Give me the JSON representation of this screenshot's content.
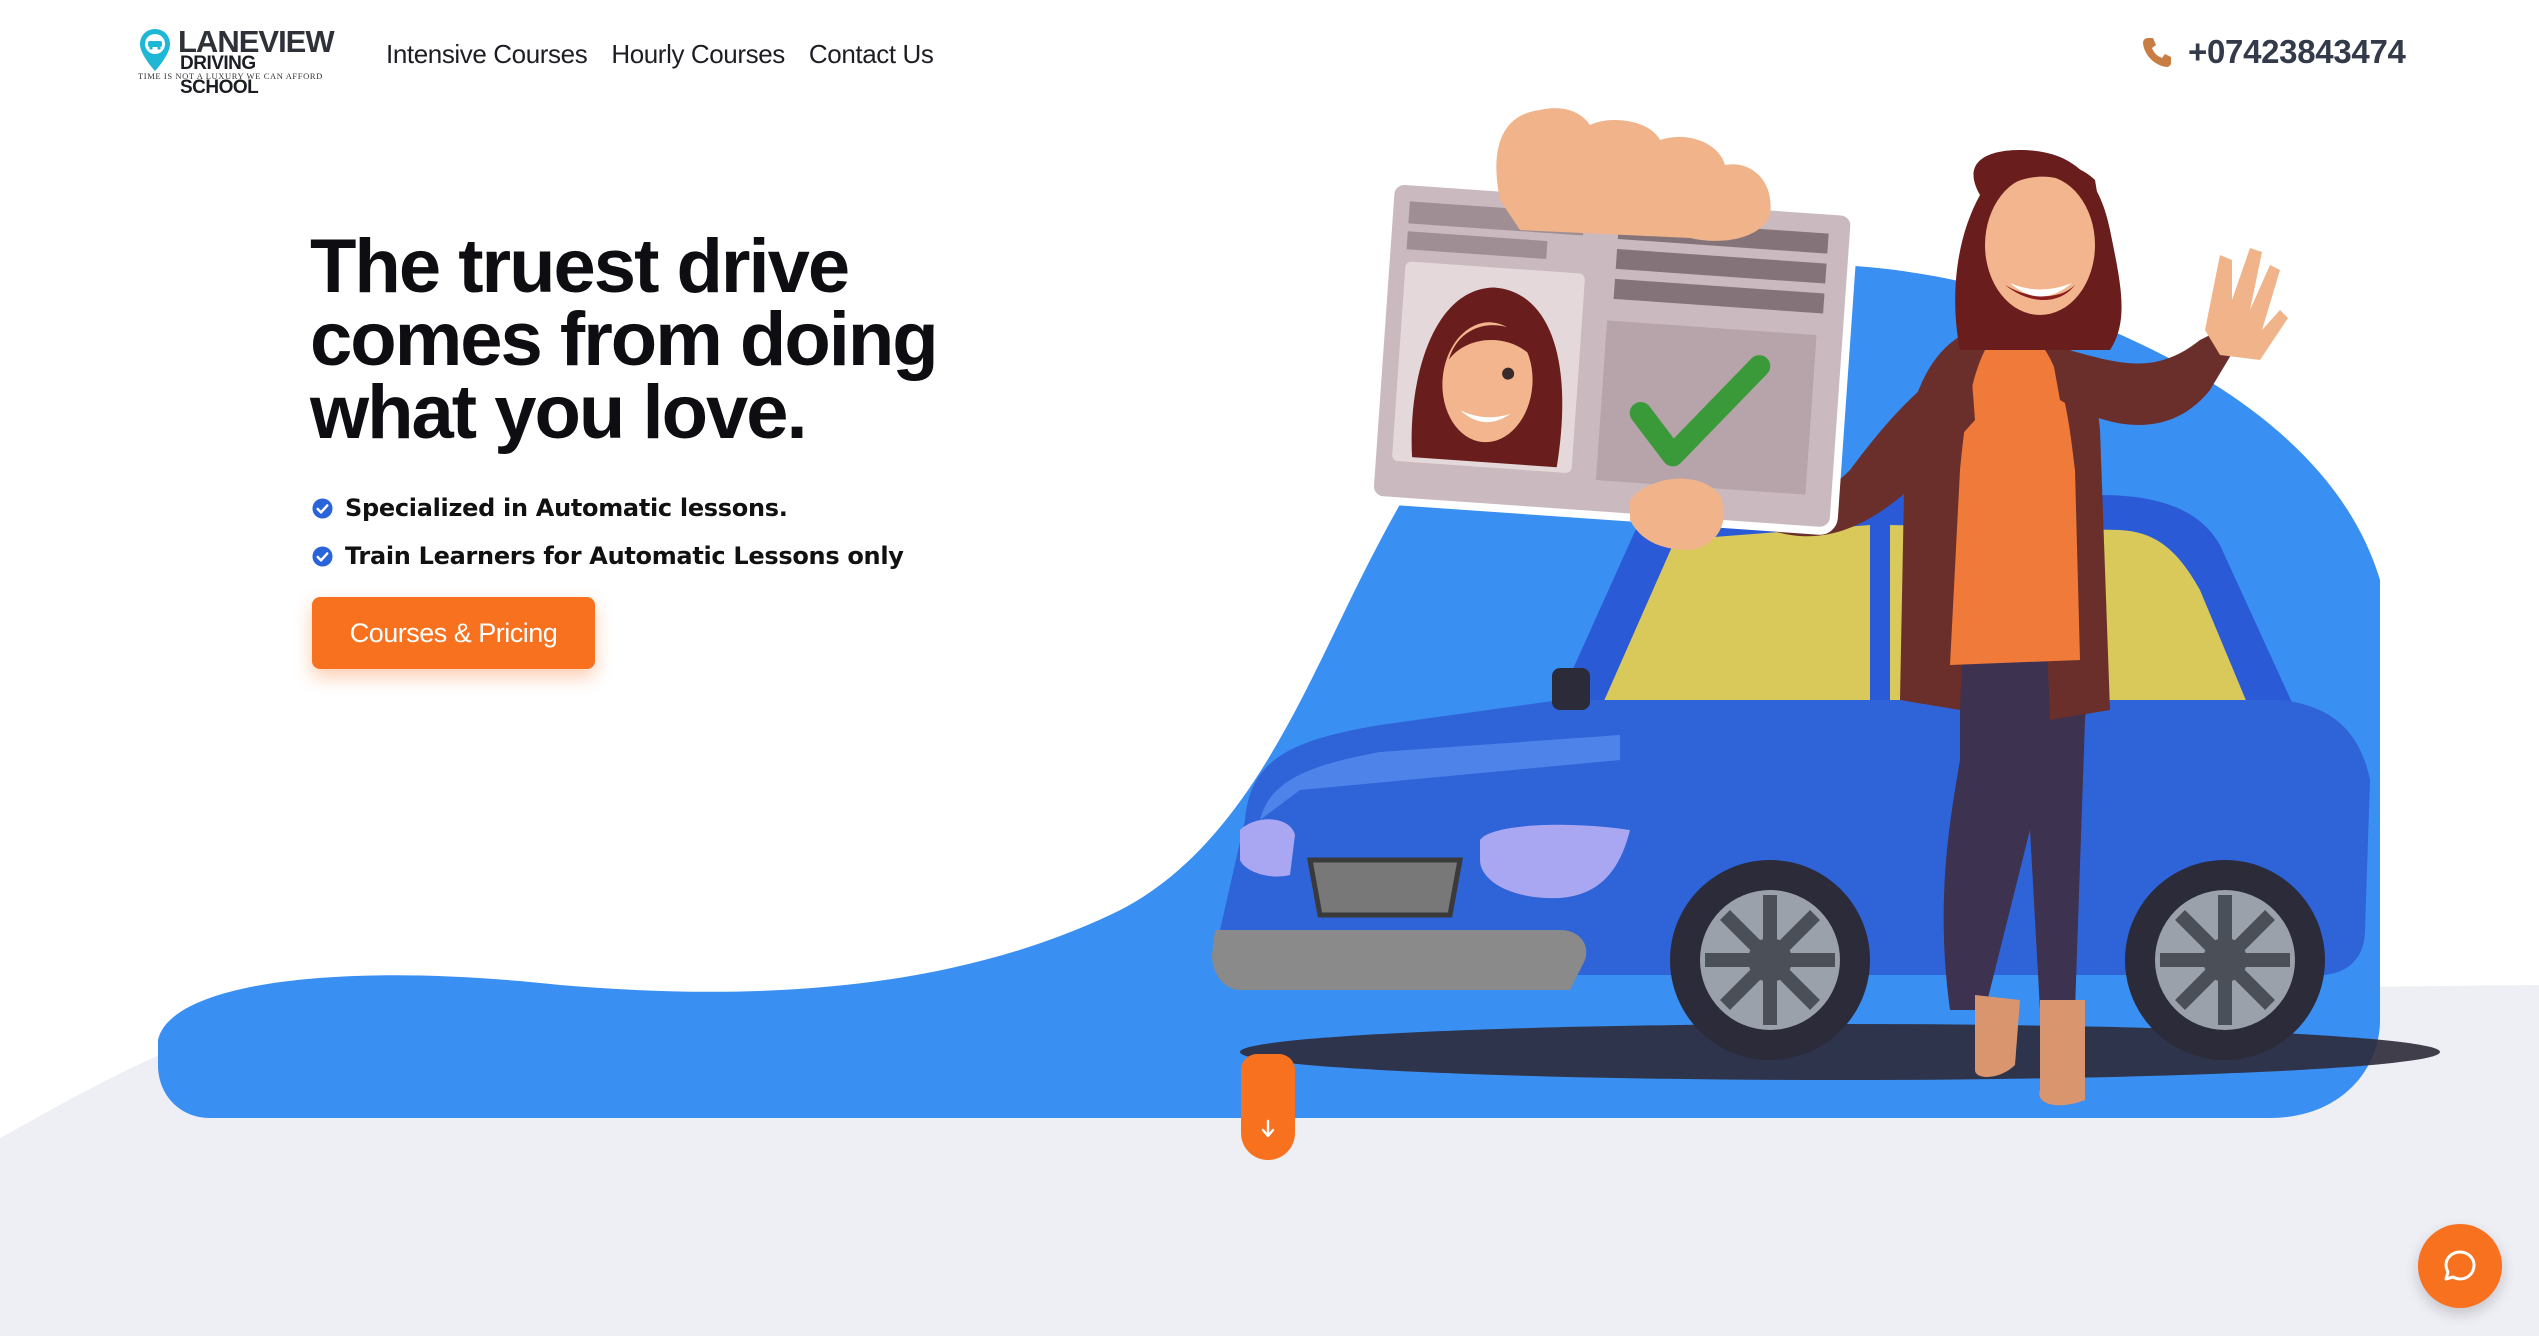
{
  "brand": {
    "name": "LANEVIEW",
    "subtitle": "DRIVING SCHOOL",
    "tagline": "TIME IS NOT A LUXURY WE CAN AFFORD"
  },
  "nav": {
    "items": [
      {
        "label": "Intensive Courses"
      },
      {
        "label": "Hourly Courses"
      },
      {
        "label": "Contact Us"
      }
    ]
  },
  "header": {
    "phone": "+07423843474",
    "phone_icon": "phone-icon"
  },
  "hero": {
    "title": "The truest drive comes from doing what you love.",
    "features": [
      {
        "text": "Specialized in Automatic lessons.",
        "icon": "check-circle-icon"
      },
      {
        "text": "Train Learners for Automatic Lessons only",
        "icon": "check-circle-icon"
      }
    ],
    "cta_label": "Courses & Pricing"
  },
  "icons": {
    "scroll": "arrow-down-icon",
    "chat": "chat-bubble-icon"
  },
  "colors": {
    "accent": "#f7711e",
    "brand_blue": "#3a8ff2",
    "check_blue": "#2b63d9",
    "bg_gray": "#eeeef5",
    "text_dark": "#0d0d12"
  }
}
